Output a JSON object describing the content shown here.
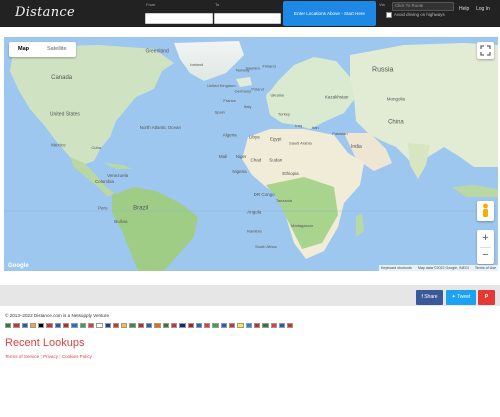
{
  "header": {
    "brand": "Distance",
    "from_label": "From",
    "from_value": "",
    "to_label": "To",
    "to_value": "",
    "go_button": "Enter Locations Above - Start Here",
    "via_label": "Via",
    "via_placeholder": "Click To Route",
    "avoid_label": "Avoid driving on highways",
    "help": "Help",
    "login": "Log In"
  },
  "map": {
    "types": [
      "Map",
      "Satellite"
    ],
    "selected_type": "Map",
    "google_logo": "Google",
    "attribution": [
      "Keyboard shortcuts",
      "Map data ©2022 Google, INEGI",
      "Terms of Use"
    ],
    "zoom_in": "+",
    "zoom_out": "−",
    "labels": [
      {
        "text": "Greenland",
        "lon": -42,
        "lat": 72,
        "size": 5
      },
      {
        "text": "Canada",
        "lon": -100,
        "lat": 58,
        "size": 6
      },
      {
        "text": "United States",
        "lon": -98,
        "lat": 39,
        "size": 5
      },
      {
        "text": "Mexico",
        "lon": -102,
        "lat": 23,
        "size": 4.5
      },
      {
        "text": "Cuba",
        "lon": -79,
        "lat": 21.5,
        "size": 4
      },
      {
        "text": "Venezuela",
        "lon": -66,
        "lat": 7,
        "size": 4.5
      },
      {
        "text": "Colombia",
        "lon": -74,
        "lat": 4,
        "size": 4.5
      },
      {
        "text": "Peru",
        "lon": -75,
        "lat": -10,
        "size": 4.5
      },
      {
        "text": "Brazil",
        "lon": -52,
        "lat": -10,
        "size": 6
      },
      {
        "text": "Bolivia",
        "lon": -64,
        "lat": -17,
        "size": 4.5
      },
      {
        "text": "North Atlantic Ocean",
        "lon": -40,
        "lat": 32,
        "size": 4.5
      },
      {
        "text": "Iceland",
        "lon": -18,
        "lat": 65,
        "size": 4
      },
      {
        "text": "Norway",
        "lon": 10,
        "lat": 62,
        "size": 4
      },
      {
        "text": "Sweden",
        "lon": 16,
        "lat": 63,
        "size": 4
      },
      {
        "text": "Finland",
        "lon": 26,
        "lat": 64,
        "size": 4
      },
      {
        "text": "United Kingdom",
        "lon": -3,
        "lat": 54,
        "size": 4
      },
      {
        "text": "Poland",
        "lon": 19,
        "lat": 52,
        "size": 4
      },
      {
        "text": "Ukraine",
        "lon": 31,
        "lat": 49,
        "size": 4
      },
      {
        "text": "France",
        "lon": 2,
        "lat": 46,
        "size": 4
      },
      {
        "text": "Germany",
        "lon": 10,
        "lat": 51,
        "size": 4
      },
      {
        "text": "Spain",
        "lon": -4,
        "lat": 40,
        "size": 4
      },
      {
        "text": "Italy",
        "lon": 13,
        "lat": 43,
        "size": 4
      },
      {
        "text": "Turkey",
        "lon": 35,
        "lat": 39,
        "size": 4
      },
      {
        "text": "Russia",
        "lon": 95,
        "lat": 62,
        "size": 7
      },
      {
        "text": "Kazakhstan",
        "lon": 67,
        "lat": 48,
        "size": 4.5
      },
      {
        "text": "Mongolia",
        "lon": 103,
        "lat": 47,
        "size": 4.5
      },
      {
        "text": "China",
        "lon": 103,
        "lat": 35,
        "size": 6
      },
      {
        "text": "Iran",
        "lon": 54,
        "lat": 32,
        "size": 4
      },
      {
        "text": "Iraq",
        "lon": 44,
        "lat": 33,
        "size": 4
      },
      {
        "text": "Pakistan",
        "lon": 69,
        "lat": 29,
        "size": 4
      },
      {
        "text": "India",
        "lon": 79,
        "lat": 22,
        "size": 5
      },
      {
        "text": "Saudi Arabia",
        "lon": 45,
        "lat": 24,
        "size": 4
      },
      {
        "text": "Algeria",
        "lon": 2,
        "lat": 28,
        "size": 4.5
      },
      {
        "text": "Libya",
        "lon": 17,
        "lat": 27,
        "size": 4.5
      },
      {
        "text": "Egypt",
        "lon": 30,
        "lat": 26,
        "size": 4.5
      },
      {
        "text": "Mali",
        "lon": -2,
        "lat": 17,
        "size": 4.5
      },
      {
        "text": "Niger",
        "lon": 9,
        "lat": 17,
        "size": 4.5
      },
      {
        "text": "Chad",
        "lon": 18,
        "lat": 15,
        "size": 4.5
      },
      {
        "text": "Sudan",
        "lon": 30,
        "lat": 15,
        "size": 4.5
      },
      {
        "text": "Ethiopia",
        "lon": 39,
        "lat": 8,
        "size": 4.5
      },
      {
        "text": "Nigeria",
        "lon": 8,
        "lat": 9,
        "size": 4.5
      },
      {
        "text": "DR Congo",
        "lon": 23,
        "lat": -3,
        "size": 4.5
      },
      {
        "text": "Tanzania",
        "lon": 35,
        "lat": -6,
        "size": 4
      },
      {
        "text": "Angola",
        "lon": 17,
        "lat": -12,
        "size": 4.5
      },
      {
        "text": "Namibia",
        "lon": 17,
        "lat": -22,
        "size": 4
      },
      {
        "text": "South Africa",
        "lon": 24,
        "lat": -30,
        "size": 4
      },
      {
        "text": "Madagascar",
        "lon": 46,
        "lat": -19,
        "size": 4
      }
    ]
  },
  "social": {
    "facebook": "f Share",
    "twitter": "✦ Tweet",
    "pinterest": "P"
  },
  "footer": {
    "copyright": "© 2013–2022 Distance.com is a Netsupply Venture",
    "recent_title": "Recent Lookups",
    "links": [
      "Terms of Service",
      "Privacy",
      "Cookies Policy"
    ],
    "flags": [
      "#2e7d32",
      "#d32f2f",
      "#1565c0",
      "#f9a825",
      "#000000",
      "#d32f2f",
      "#1565c0",
      "#c62828",
      "#1976d2",
      "#43a047",
      "#e53935",
      "#ffffff",
      "#0d47a1",
      "#d32f2f",
      "#fbc02d",
      "#388e3c",
      "#c62828",
      "#1565c0",
      "#ef6c00",
      "#2e7d32",
      "#d32f2f",
      "#1a237e",
      "#b71c1c",
      "#0277bd",
      "#e53935",
      "#43a047",
      "#1565c0",
      "#d32f2f",
      "#ffeb3b",
      "#1e88e5",
      "#c62828",
      "#2e7d32",
      "#e53935",
      "#1565c0",
      "#d32f2f"
    ]
  }
}
